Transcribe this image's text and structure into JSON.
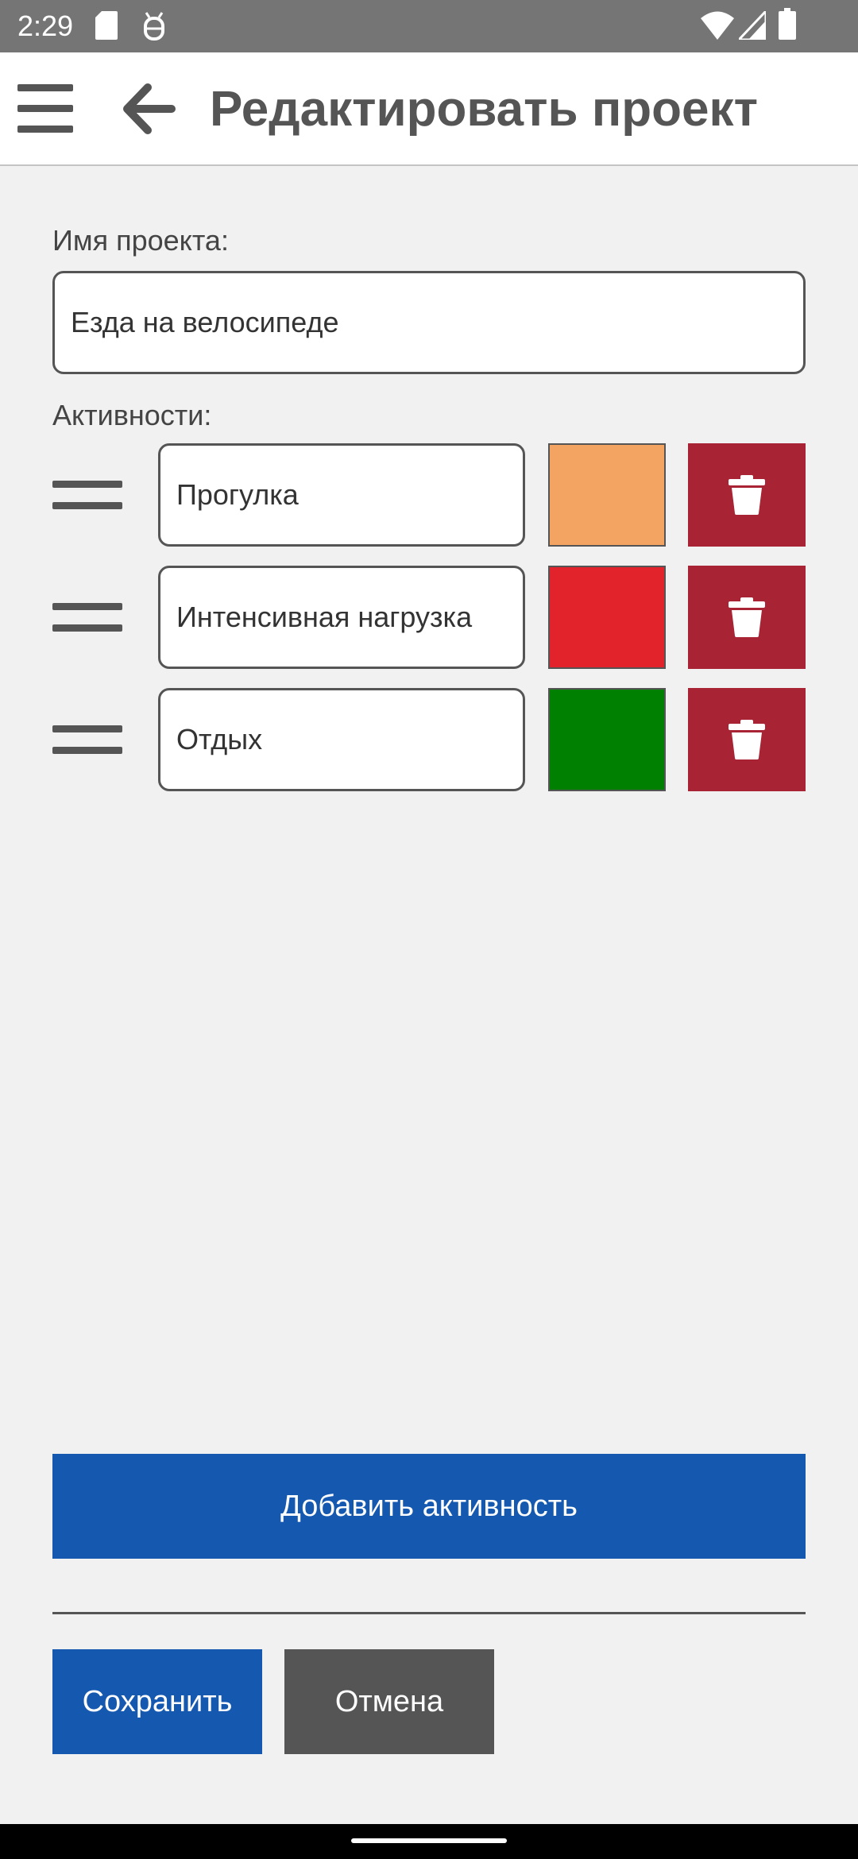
{
  "status_bar": {
    "time": "2:29",
    "left_icons": [
      "sd-card-icon",
      "debug-icon"
    ],
    "right_icons": [
      "wifi-icon",
      "cell-signal-icon",
      "battery-icon"
    ]
  },
  "app_bar": {
    "menu_icon": "hamburger-menu-icon",
    "back_icon": "arrow-back-icon",
    "title": "Редактировать проект"
  },
  "form": {
    "project_name_label": "Имя проекта:",
    "project_name_value": "Езда на велосипеде",
    "activities_label": "Активности:",
    "activities": [
      {
        "name": "Прогулка",
        "color": "#f4a462"
      },
      {
        "name": "Интенсивная нагрузка",
        "color": "#e2232b"
      },
      {
        "name": "Отдых",
        "color": "#008000"
      }
    ],
    "delete_icon": "trash-icon",
    "drag_icon": "drag-handle-icon"
  },
  "actions": {
    "add_activity_label": "Добавить активность",
    "save_label": "Сохранить",
    "cancel_label": "Отмена"
  },
  "colors": {
    "primary": "#1458b0",
    "danger": "#a82333",
    "secondary": "#555555",
    "background": "#f1f1f1"
  }
}
